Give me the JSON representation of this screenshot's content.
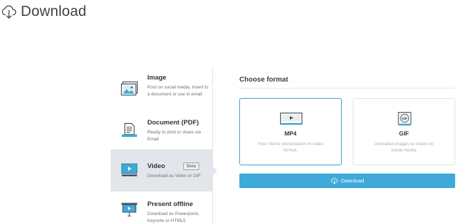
{
  "header": {
    "title": "Download",
    "icon": "cloud-download-icon"
  },
  "options": [
    {
      "id": "image",
      "title": "Image",
      "desc": "Post on social media, insert to a document or use in email",
      "icon": "image-icon"
    },
    {
      "id": "pdf",
      "title": "Document (PDF)",
      "desc": "Ready to print or share via Email",
      "icon": "document-icon"
    },
    {
      "id": "video",
      "title": "Video",
      "desc": "Download as Video or GIF",
      "icon": "video-icon",
      "badge": "Beta",
      "selected": true
    },
    {
      "id": "offline",
      "title": "Present offline",
      "desc": "Download as Powerpoint, Keynote or HTML5",
      "icon": "presentation-icon"
    }
  ],
  "format_panel": {
    "title": "Choose format",
    "formats": [
      {
        "id": "mp4",
        "name": "MP4",
        "desc": "Your Visme presentation in video format.",
        "icon": "video-file-icon",
        "selected": true
      },
      {
        "id": "gif",
        "name": "GIF",
        "desc": "Animated images to share on social media.",
        "icon": "gif-icon"
      }
    ],
    "download_label": "Download"
  },
  "colors": {
    "accent": "#3fa9d9",
    "selected_bg": "#e2e6ea",
    "selected_border": "#4aa8d8"
  }
}
